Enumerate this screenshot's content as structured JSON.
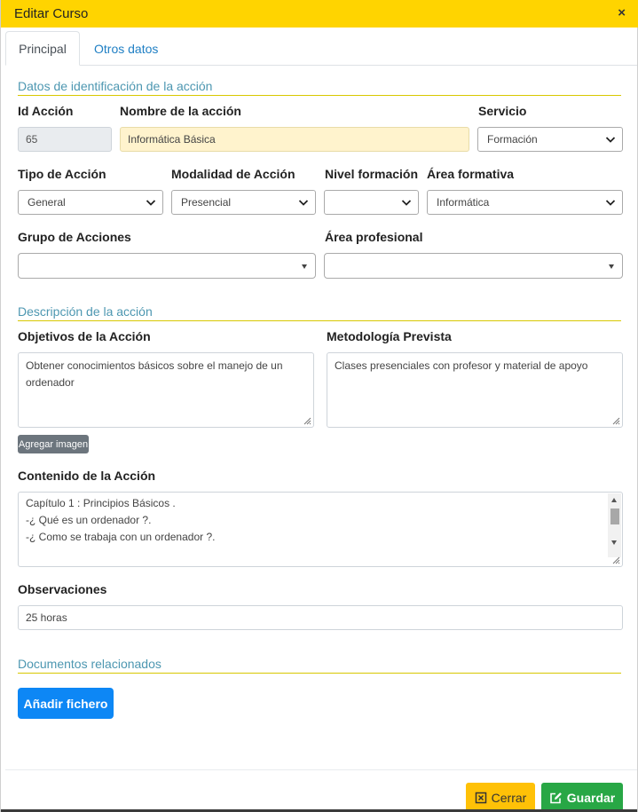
{
  "modal": {
    "title": "Editar Curso",
    "close_glyph": "×"
  },
  "tabs": [
    {
      "label": "Principal",
      "active": true
    },
    {
      "label": "Otros datos",
      "active": false
    }
  ],
  "section_identificacion": {
    "title": "Datos de identificación de la acción"
  },
  "fields": {
    "id_accion": {
      "label": "Id Acción",
      "value": "65"
    },
    "nombre": {
      "label": "Nombre de la acción",
      "value": "Informática Básica"
    },
    "servicio": {
      "label": "Servicio",
      "value": "Formación"
    },
    "tipo": {
      "label": "Tipo de Acción",
      "value": "General"
    },
    "modalidad": {
      "label": "Modalidad de Acción",
      "value": "Presencial"
    },
    "nivel": {
      "label": "Nivel formación",
      "value": ""
    },
    "area_formativa": {
      "label": "Área formativa",
      "value": "Informática"
    },
    "grupo": {
      "label": "Grupo de Acciones",
      "value": ""
    },
    "area_profesional": {
      "label": "Área profesional",
      "value": ""
    }
  },
  "section_descripcion": {
    "title": "Descripción de la acción"
  },
  "descripcion": {
    "objetivos": {
      "label": "Objetivos de la Acción",
      "value": "Obtener conocimientos básicos sobre el manejo de un ordenador"
    },
    "metodologia": {
      "label": "Metodología Prevista",
      "value": "Clases presenciales con profesor y material de apoyo"
    },
    "add_image_label": "Agregar imagen",
    "contenido": {
      "label": "Contenido de la Acción",
      "lines": [
        "Capítulo 1 : Principios Básicos .",
        "-¿ Qué es un ordenador ?.",
        "-¿ Como se trabaja con un ordenador ?."
      ]
    },
    "observaciones": {
      "label": "Observaciones",
      "value": "25 horas"
    }
  },
  "section_documentos": {
    "title": "Documentos relacionados",
    "add_file_label": "Añadir fichero"
  },
  "footer": {
    "cerrar_label": "Cerrar",
    "guardar_label": "Guardar"
  },
  "colors": {
    "header": "#ffd400",
    "section_title": "#4d97b1",
    "section_rule": "#d8c800",
    "primary": "#0d87f5",
    "warning": "#ffc107",
    "success": "#28a745",
    "highlight_input": "#fff3cd"
  },
  "icons": {
    "close": "close-icon",
    "select_arrow": "chevron-down-icon",
    "cerrar": "close-box-icon",
    "guardar": "edit-icon"
  }
}
